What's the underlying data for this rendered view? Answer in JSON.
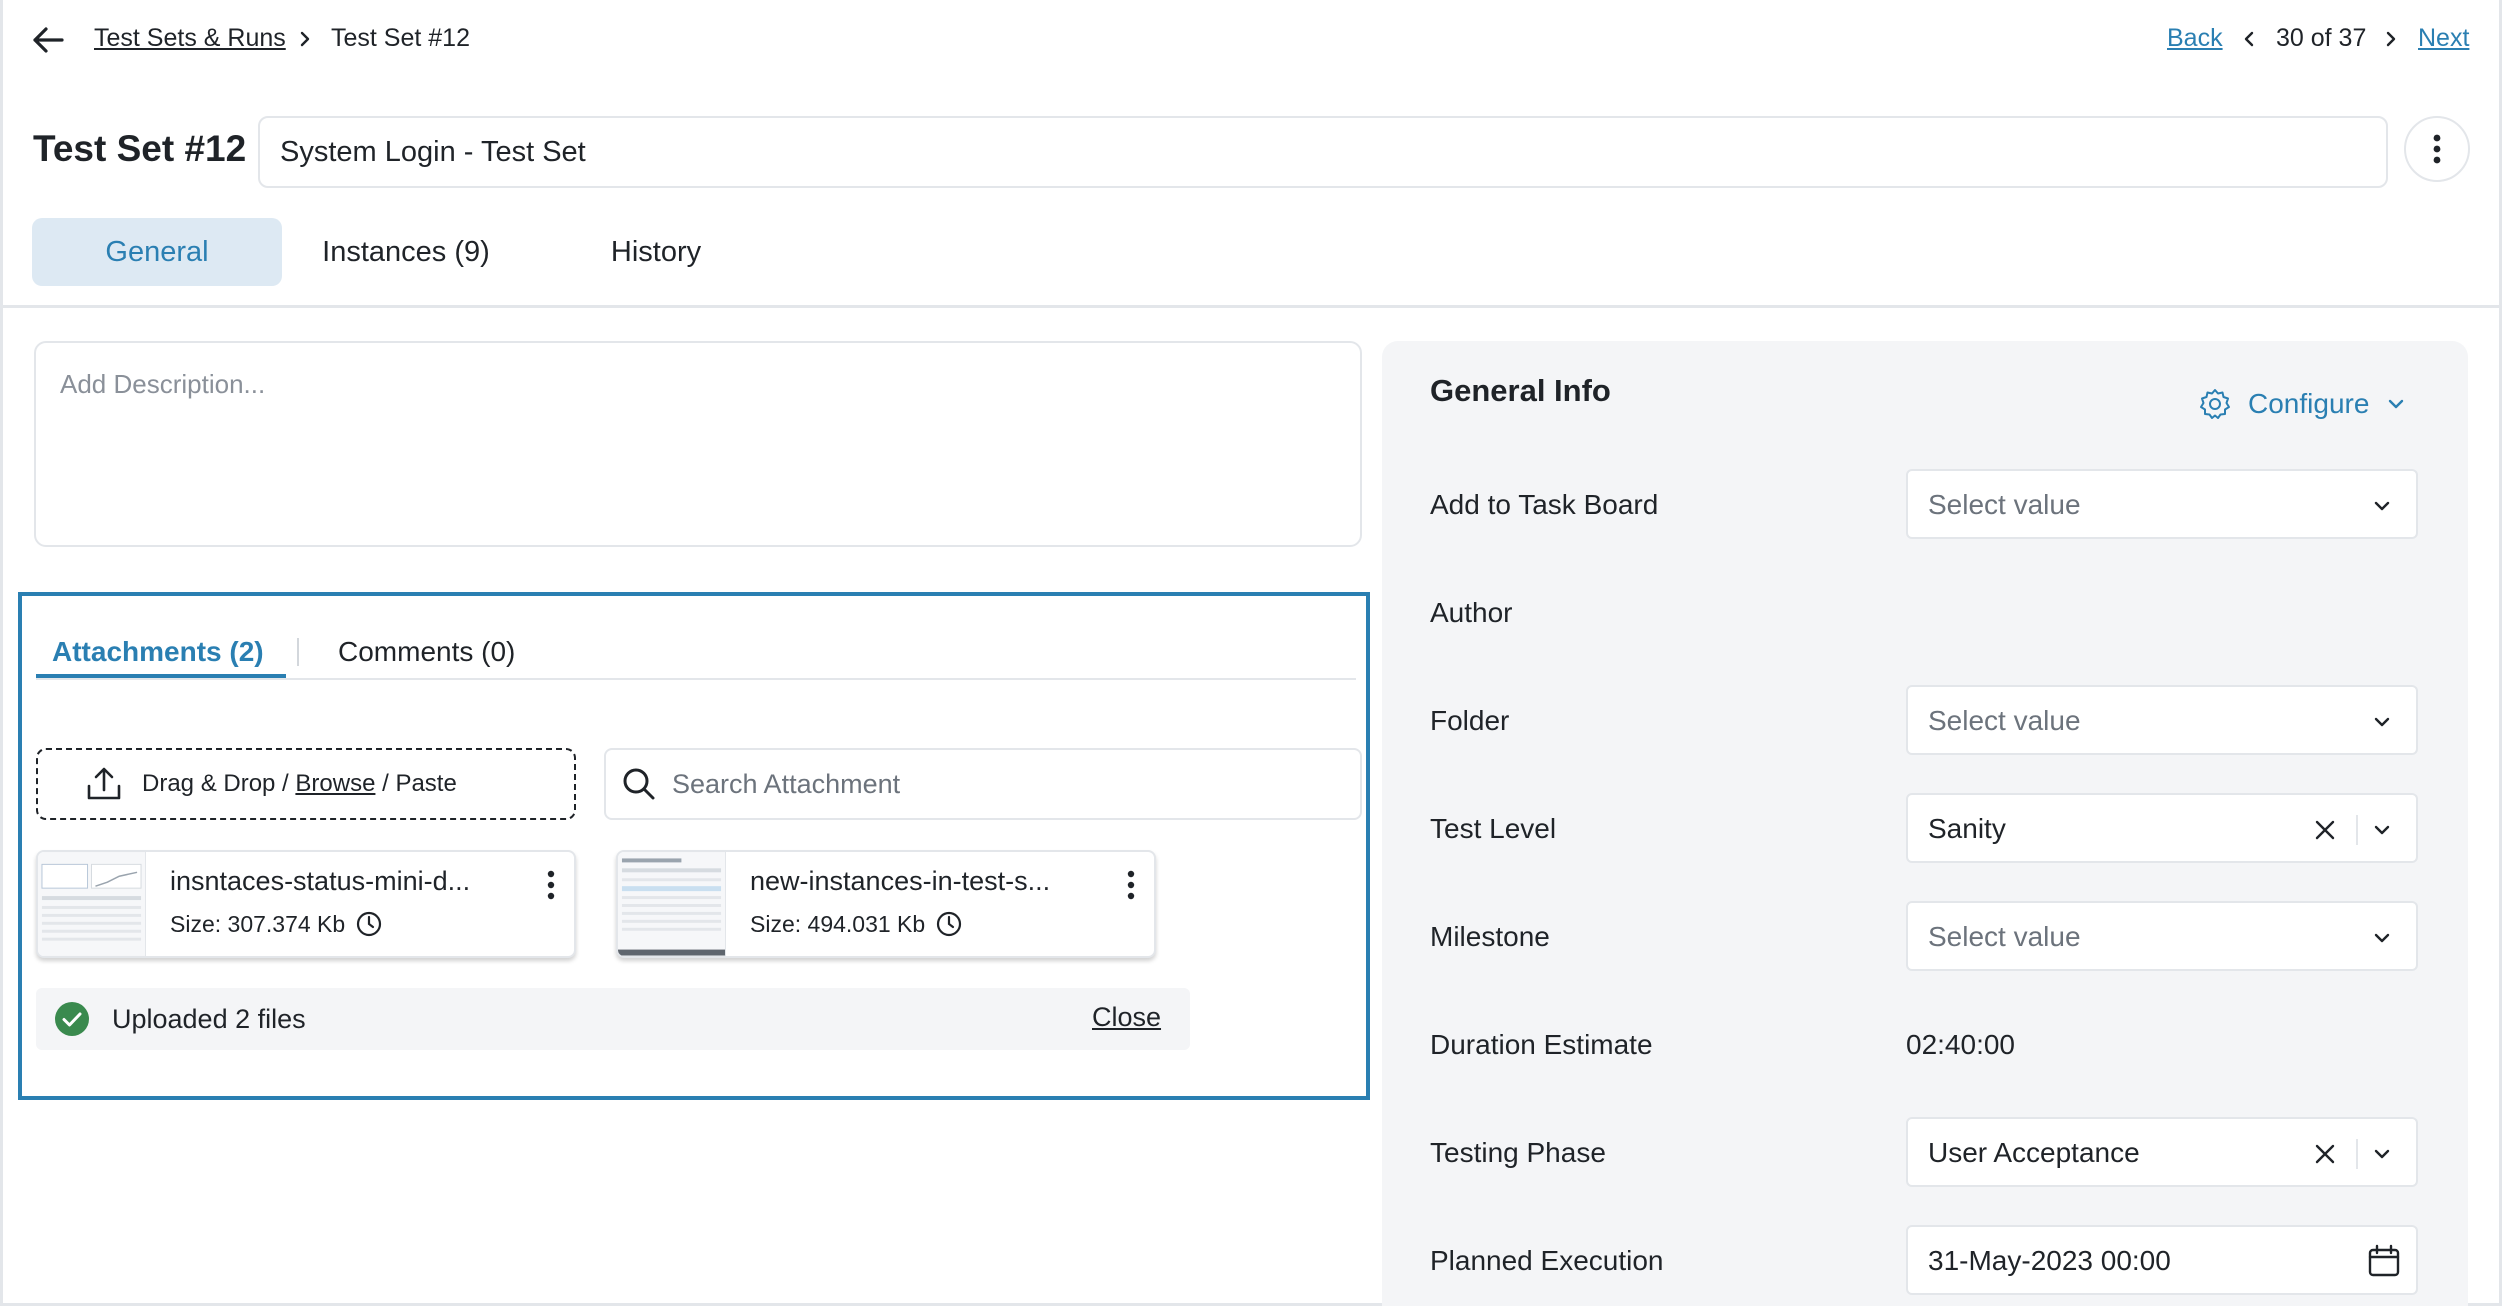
{
  "breadcrumb": {
    "parent": "Test Sets & Runs",
    "current": "Test Set #12"
  },
  "pager": {
    "back": "Back",
    "count": "30 of 37",
    "next": "Next"
  },
  "header": {
    "title": "Test Set #12",
    "name_value": "System Login - Test Set"
  },
  "tabs": [
    {
      "label": "General",
      "active": true
    },
    {
      "label": "Instances (9)",
      "active": false
    },
    {
      "label": "History",
      "active": false
    }
  ],
  "description": {
    "placeholder": "Add Description..."
  },
  "attachments_panel": {
    "tabs": [
      {
        "label": "Attachments (2)",
        "active": true
      },
      {
        "label": "Comments (0)",
        "active": false
      }
    ],
    "dropzone": {
      "drag": "Drag & Drop",
      "sep1": " / ",
      "browse": "Browse",
      "sep2": " / ",
      "paste": "Paste"
    },
    "search_placeholder": "Search Attachment",
    "files": [
      {
        "name": "insntaces-status-mini-d...",
        "size": "Size: 307.374 Kb"
      },
      {
        "name": "new-instances-in-test-s...",
        "size": "Size: 494.031 Kb"
      }
    ],
    "status": {
      "text": "Uploaded 2 files",
      "close": "Close"
    }
  },
  "general_info": {
    "title": "General Info",
    "configure": "Configure",
    "fields": [
      {
        "label": "Add to Task Board",
        "type": "select",
        "value": "",
        "placeholder": "Select value"
      },
      {
        "label": "Author",
        "type": "static",
        "value": ""
      },
      {
        "label": "Folder",
        "type": "select",
        "value": "",
        "placeholder": "Select value"
      },
      {
        "label": "Test Level",
        "type": "select",
        "value": "Sanity"
      },
      {
        "label": "Milestone",
        "type": "select",
        "value": "",
        "placeholder": "Select value"
      },
      {
        "label": "Duration Estimate",
        "type": "static",
        "value": "02:40:00"
      },
      {
        "label": "Testing Phase",
        "type": "select",
        "value": "User Acceptance"
      },
      {
        "label": "Planned Execution",
        "type": "date",
        "value": "31-May-2023 00:00"
      }
    ]
  },
  "colors": {
    "accent": "#2a7fb2",
    "active_tab_bg": "#dde9f3",
    "success": "#3a8a4e",
    "panel_bg": "#f4f5f7",
    "border": "#e3e6ea"
  },
  "icons": {
    "back": "arrow-left-icon",
    "crumb_separator": "chevron-right-icon",
    "more": "kebab-menu-icon",
    "upload": "upload-icon",
    "search": "search-icon",
    "clock": "clock-icon",
    "success": "check-circle-icon",
    "gear": "gear-icon",
    "dropdown": "chevron-down-icon",
    "clear": "close-icon",
    "calendar": "calendar-icon"
  }
}
